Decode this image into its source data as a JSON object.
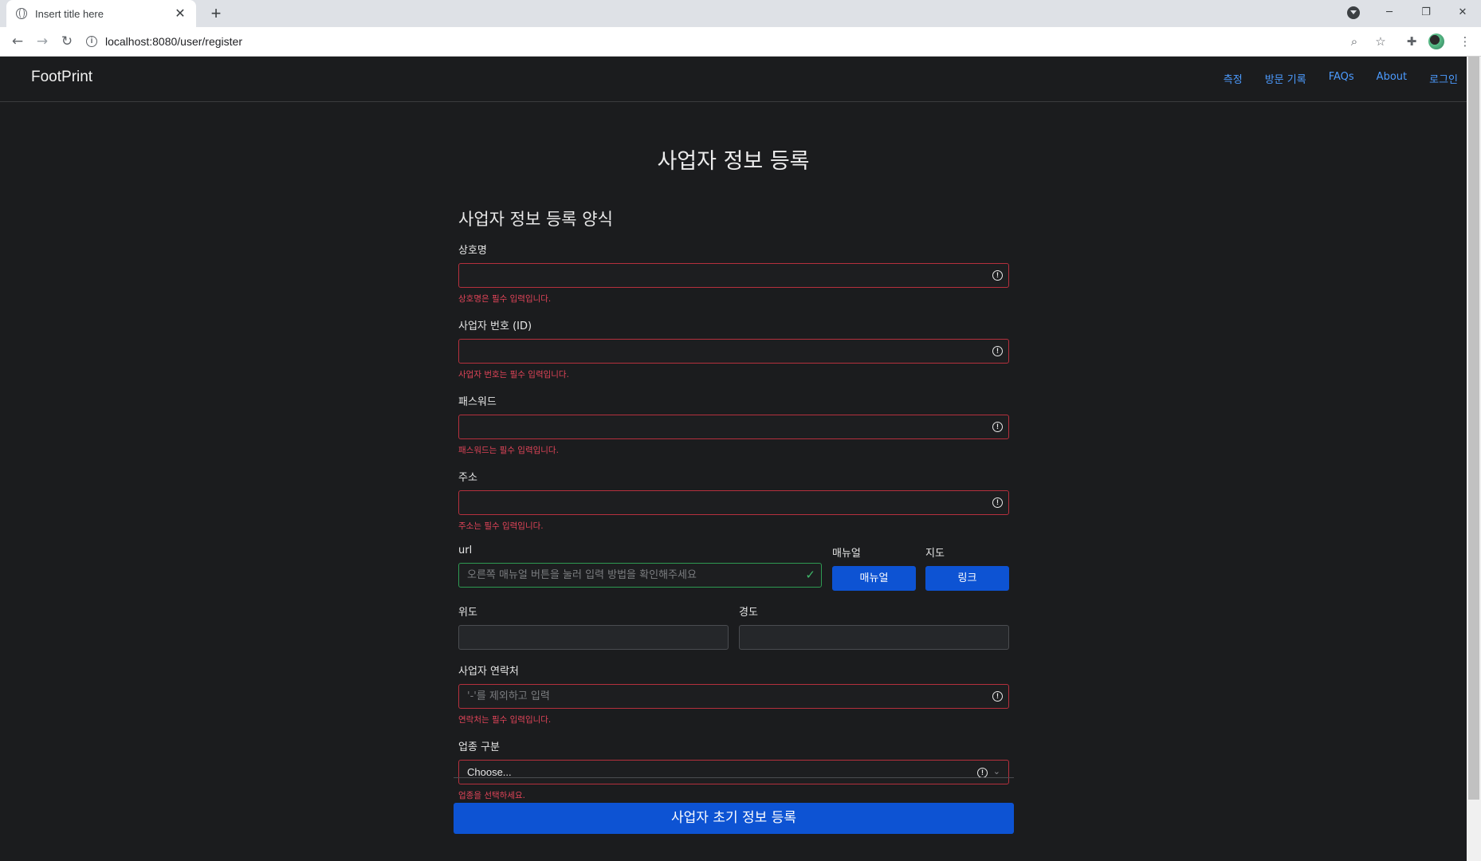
{
  "browser": {
    "tab_title": "Insert title here",
    "url": "localhost:8080/user/register"
  },
  "navbar": {
    "brand": "FootPrint",
    "links": [
      "측정",
      "방문 기록",
      "FAQs",
      "About",
      "로그인"
    ]
  },
  "page": {
    "title": "사업자 정보 등록",
    "form_heading": "사업자 정보 등록 양식"
  },
  "fields": {
    "company_name": {
      "label": "상호명",
      "value": "",
      "error": "상호명은 필수 입력입니다."
    },
    "business_id": {
      "label": "사업자 번호 (ID)",
      "value": "",
      "error": "사업자 번호는 필수 입력입니다."
    },
    "password": {
      "label": "패스워드",
      "value": "",
      "error": "패스워드는 필수 입력입니다."
    },
    "address": {
      "label": "주소",
      "value": "",
      "error": "주소는 필수 입력입니다."
    },
    "url": {
      "label": "url",
      "placeholder": "오른쪽 매뉴얼 버튼을 눌러 입력 방법을 확인해주세요"
    },
    "manual": {
      "label": "매뉴얼",
      "button": "매뉴얼"
    },
    "map": {
      "label": "지도",
      "button": "링크"
    },
    "latitude": {
      "label": "위도",
      "value": ""
    },
    "longitude": {
      "label": "경도",
      "value": ""
    },
    "contact": {
      "label": "사업자 연락처",
      "placeholder": "'-'를 제외하고 입력",
      "error": "연락처는 필수 입력입니다."
    },
    "category": {
      "label": "업종 구분",
      "selected": "Choose...",
      "error": "업종을 선택하세요."
    }
  },
  "submit_label": "사업자 초기 정보 등록",
  "colors": {
    "background": "#1b1c1e",
    "accent": "#0d53d3",
    "link": "#4c9bff",
    "error": "#e04458",
    "valid": "#2e9a52"
  }
}
